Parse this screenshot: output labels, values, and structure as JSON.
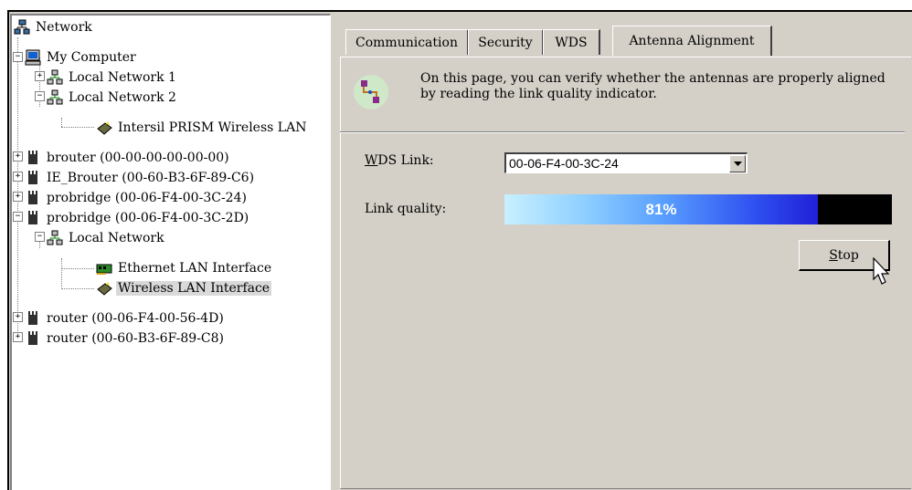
{
  "tree": {
    "items": [
      {
        "label": "Network",
        "icon": "network-icon"
      },
      {
        "label": "My Computer",
        "icon": "computer-icon",
        "expander": "−"
      },
      {
        "label": "Local Network 1",
        "icon": "local-network-icon",
        "expander": "+"
      },
      {
        "label": "Local Network 2",
        "icon": "local-network-icon",
        "expander": "−"
      },
      {
        "label": "Intersil PRISM  Wireless LAN",
        "icon": "wireless-card-icon"
      },
      {
        "label": "brouter (00-00-00-00-00-00)",
        "icon": "router-device-icon",
        "expander": "+"
      },
      {
        "label": "IE_Brouter (00-60-B3-6F-89-C6)",
        "icon": "router-device-icon",
        "expander": "+"
      },
      {
        "label": "probridge (00-06-F4-00-3C-24)",
        "icon": "router-device-icon",
        "expander": "+"
      },
      {
        "label": "probridge (00-06-F4-00-3C-2D)",
        "icon": "router-device-icon",
        "expander": "−"
      },
      {
        "label": "Local Network",
        "icon": "local-network-icon",
        "expander": "−"
      },
      {
        "label": "Ethernet LAN Interface",
        "icon": "ethernet-card-icon"
      },
      {
        "label": "Wireless LAN Interface",
        "icon": "wireless-card-icon"
      },
      {
        "label": "router (00-06-F4-00-56-4D)",
        "icon": "router-device-icon",
        "expander": "+"
      },
      {
        "label": "router (00-60-B3-6F-89-C8)",
        "icon": "router-device-icon",
        "expander": "+"
      }
    ]
  },
  "tabs": [
    {
      "label": "Communication"
    },
    {
      "label": "Security"
    },
    {
      "label": "WDS"
    },
    {
      "label": "Antenna Alignment"
    }
  ],
  "info": {
    "text": "On this page, you can verify whether the antennas are properly aligned by reading the link quality indicator."
  },
  "wds": {
    "label": "WDS Link:",
    "value": "00-06-F4-00-3C-24"
  },
  "link_quality": {
    "label": "Link quality:",
    "percent": 81,
    "text": "81%"
  },
  "stop_button": {
    "label": "Stop"
  },
  "colors": {
    "panel": "#d4d0c8",
    "selection": "#d9d9d9",
    "bar_start": "#c8f0ff",
    "bar_end": "#2020d8",
    "bar_empty": "#000000"
  }
}
